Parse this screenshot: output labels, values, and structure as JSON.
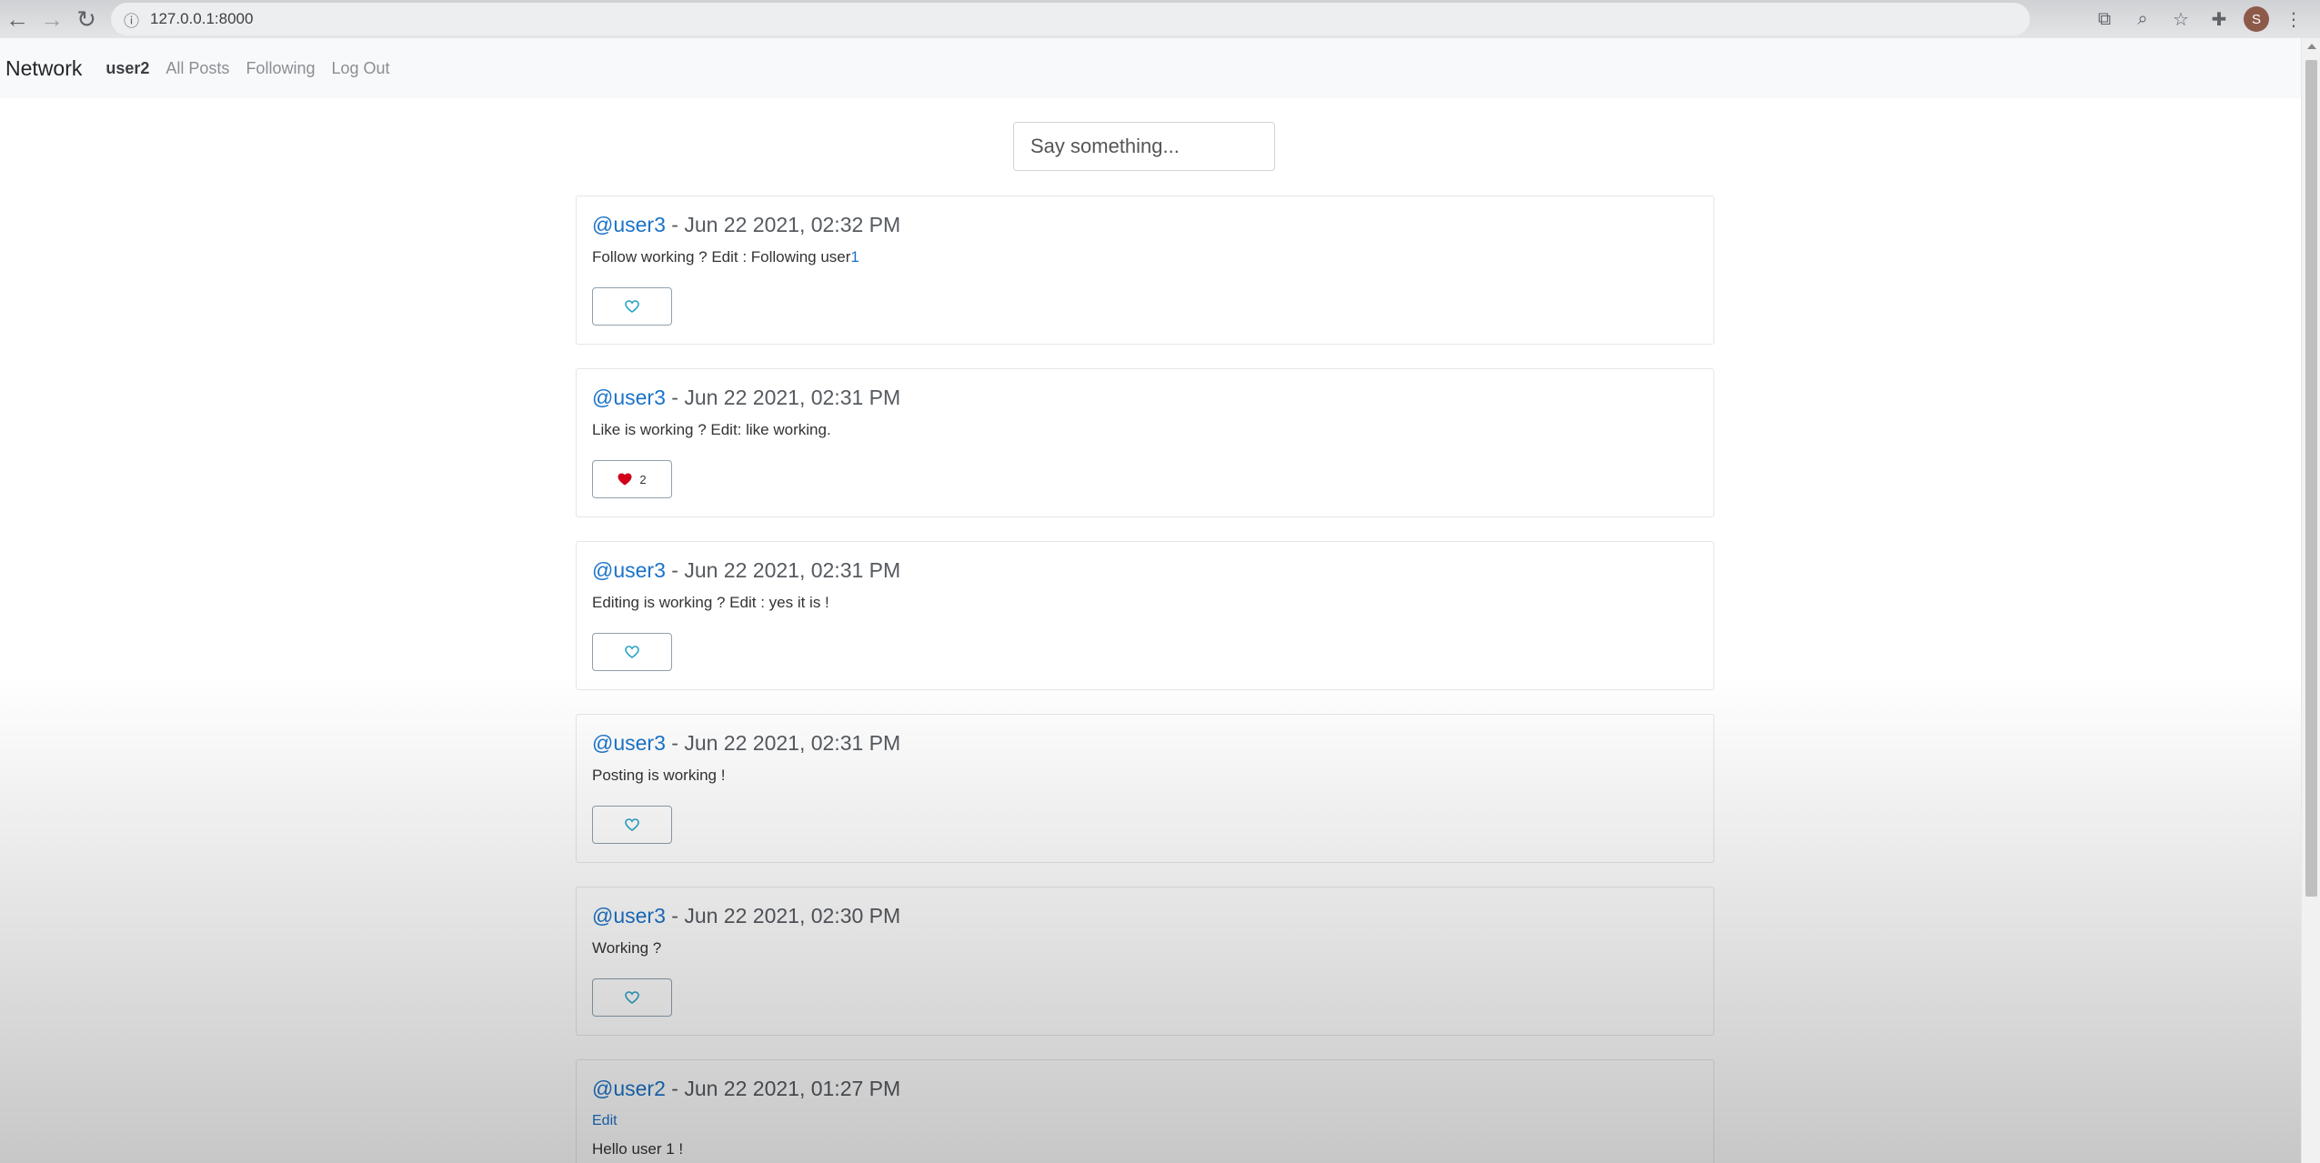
{
  "browser": {
    "url": "127.0.0.1:8000",
    "avatar_letter": "S"
  },
  "navbar": {
    "brand": "Network",
    "user": "user2",
    "all_posts": "All Posts",
    "following": "Following",
    "logout": "Log Out"
  },
  "composer": {
    "placeholder": "Say something..."
  },
  "posts": [
    {
      "handle": "@user3",
      "date": " - Jun 22 2021, 02:32 PM",
      "content": "Follow working ? Edit : Following user",
      "content_tail": "1",
      "liked": false,
      "likes": ""
    },
    {
      "handle": "@user3",
      "date": " - Jun 22 2021, 02:31 PM",
      "content": "Like is working ? Edit: like working.",
      "content_tail": "",
      "liked": true,
      "likes": "2"
    },
    {
      "handle": "@user3",
      "date": " - Jun 22 2021, 02:31 PM",
      "content": "Editing is working ? Edit : yes it is !",
      "content_tail": "",
      "liked": false,
      "likes": ""
    },
    {
      "handle": "@user3",
      "date": " - Jun 22 2021, 02:31 PM",
      "content": "Posting is working !",
      "content_tail": "",
      "liked": false,
      "likes": ""
    },
    {
      "handle": "@user3",
      "date": " - Jun 22 2021, 02:30 PM",
      "content": "Working ?",
      "content_tail": "",
      "liked": false,
      "likes": ""
    },
    {
      "handle": "@user2",
      "date": " - Jun 22 2021, 01:27 PM",
      "edit_label": "Edit",
      "content": "Hello user 1 !",
      "content_tail": "",
      "liked": false,
      "likes": ""
    }
  ],
  "colors": {
    "link": "#1a73c9",
    "heart_empty": "#29a3c7",
    "heart_filled": "#d0021b"
  },
  "icons": {
    "back": "arrow-left-icon",
    "forward": "arrow-right-icon",
    "reload": "reload-icon",
    "info": "info-icon",
    "translate": "translate-icon",
    "zoom": "zoom-icon",
    "bookmark": "star-icon",
    "extensions": "puzzle-icon",
    "menu": "kebab-menu-icon",
    "like": "heart-icon"
  }
}
